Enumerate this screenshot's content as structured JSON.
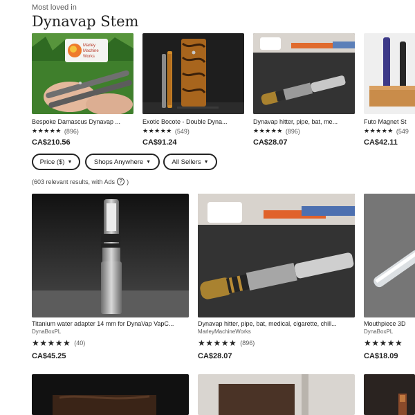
{
  "header": {
    "eyebrow": "Most loved in",
    "title": "Dynavap Stem"
  },
  "top_listings": [
    {
      "title": "Bespoke Damascus Dynavap ...",
      "stars": "★★★★★",
      "reviews": "(896)",
      "price": "CA$210.56"
    },
    {
      "title": "Exotic Bocote - Double Dyna...",
      "stars": "★★★★★",
      "reviews": "(549)",
      "price": "CA$91.24"
    },
    {
      "title": "Dynavap hitter, pipe, bat, me...",
      "stars": "★★★★★",
      "reviews": "(896)",
      "price": "CA$28.07"
    },
    {
      "title": "Futo Magnet St",
      "stars": "★★★★★",
      "reviews": "(549",
      "price": "CA$42.11"
    }
  ],
  "filters": {
    "price": "Price ($)",
    "shops": "Shops Anywhere",
    "sellers": "All Sellers",
    "caret": "▼"
  },
  "results": {
    "text": "(603 relevant results, with Ads",
    "icon": "?",
    "close": ")"
  },
  "listings": [
    {
      "title": "Titanium water adapter 14 mm for DynaVap VapC...",
      "shop": "DynaBoxPL",
      "stars": "★★★★★",
      "reviews": "(40)",
      "price": "CA$45.25"
    },
    {
      "title": "Dynavap hitter, pipe, bat, medical, cigarette, chill...",
      "shop": "MarleyMachineWorks",
      "stars": "★★★★★",
      "reviews": "(896)",
      "price": "CA$28.07"
    },
    {
      "title": "Mouthpiece 3D",
      "shop": "DynaBoxPL",
      "stars": "★★★★★",
      "reviews": "",
      "price": "CA$18.09"
    }
  ],
  "mini_logo": [
    "Marley",
    "Machine",
    "Works"
  ]
}
